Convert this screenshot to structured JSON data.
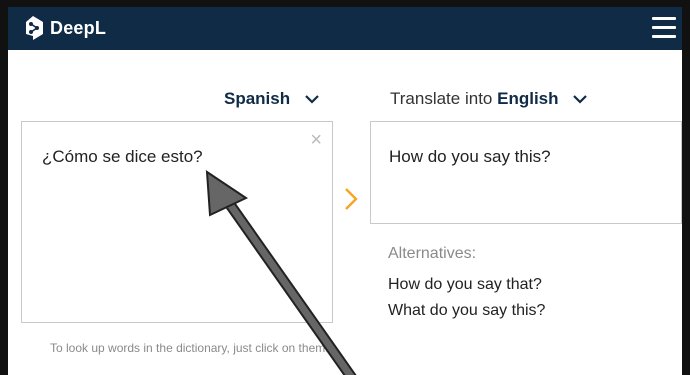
{
  "header": {
    "app_name": "DeepL",
    "brand_color": "#0f2b46",
    "logo_icon": "deepl-logo-icon",
    "menu_icon": "hamburger-menu-icon"
  },
  "source": {
    "language": "Spanish",
    "text": "¿Cómo se dice esto?",
    "clear_symbol": "×"
  },
  "target": {
    "prefix": "Translate into",
    "language": "English",
    "text": "How do you say this?"
  },
  "alternatives": {
    "label": "Alternatives:",
    "items": [
      "How do you say that?",
      "What do you say this?"
    ]
  },
  "hint": "To look up words in the dictionary, just click on them.",
  "accent_color": "#f5a623"
}
